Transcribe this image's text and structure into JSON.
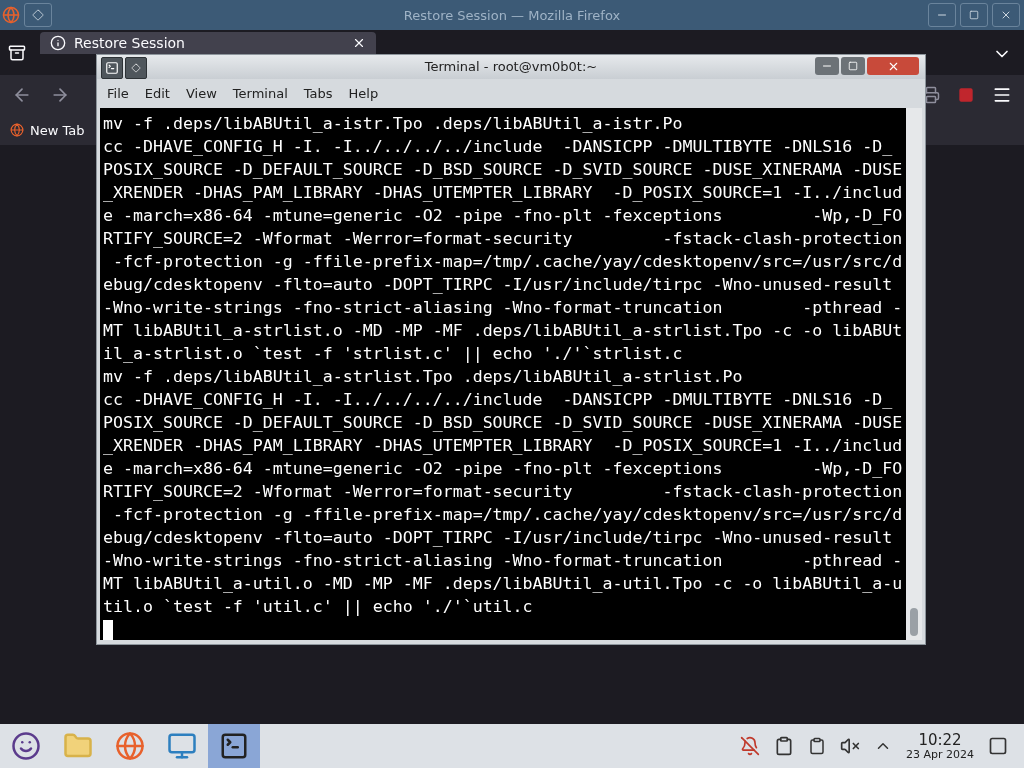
{
  "firefox": {
    "title": "Restore Session — Mozilla Firefox",
    "tab": {
      "label": "Restore Session",
      "selected": true
    },
    "bookmarks": [
      {
        "label": "New Tab"
      }
    ]
  },
  "terminal": {
    "title": "Terminal - root@vm0b0t:~",
    "menu": [
      "File",
      "Edit",
      "View",
      "Terminal",
      "Tabs",
      "Help"
    ],
    "lines": [
      "mv -f .deps/libABUtil_a-istr.Tpo .deps/libABUtil_a-istr.Po",
      "cc -DHAVE_CONFIG_H -I. -I../../../../include  -DANSICPP -DMULTIBYTE -DNLS16 -D_",
      "POSIX_SOURCE -D_DEFAULT_SOURCE -D_BSD_SOURCE -D_SVID_SOURCE -DUSE_XINERAMA -DUSE",
      "_XRENDER -DHAS_PAM_LIBRARY -DHAS_UTEMPTER_LIBRARY  -D_POSIX_SOURCE=1 -I../includ",
      "e -march=x86-64 -mtune=generic -O2 -pipe -fno-plt -fexceptions         -Wp,-D_FO",
      "RTIFY_SOURCE=2 -Wformat -Werror=format-security         -fstack-clash-protection",
      " -fcf-protection -g -ffile-prefix-map=/tmp/.cache/yay/cdesktopenv/src=/usr/src/d",
      "ebug/cdesktopenv -flto=auto -DOPT_TIRPC -I/usr/include/tirpc -Wno-unused-result",
      "-Wno-write-strings -fno-strict-aliasing -Wno-format-truncation        -pthread -",
      "MT libABUtil_a-strlist.o -MD -MP -MF .deps/libABUtil_a-strlist.Tpo -c -o libABUt",
      "il_a-strlist.o `test -f 'strlist.c' || echo './'`strlist.c",
      "mv -f .deps/libABUtil_a-strlist.Tpo .deps/libABUtil_a-strlist.Po",
      "cc -DHAVE_CONFIG_H -I. -I../../../../include  -DANSICPP -DMULTIBYTE -DNLS16 -D_",
      "POSIX_SOURCE -D_DEFAULT_SOURCE -D_BSD_SOURCE -D_SVID_SOURCE -DUSE_XINERAMA -DUSE",
      "_XRENDER -DHAS_PAM_LIBRARY -DHAS_UTEMPTER_LIBRARY  -D_POSIX_SOURCE=1 -I../includ",
      "e -march=x86-64 -mtune=generic -O2 -pipe -fno-plt -fexceptions         -Wp,-D_FO",
      "RTIFY_SOURCE=2 -Wformat -Werror=format-security         -fstack-clash-protection",
      " -fcf-protection -g -ffile-prefix-map=/tmp/.cache/yay/cdesktopenv/src=/usr/src/d",
      "ebug/cdesktopenv -flto=auto -DOPT_TIRPC -I/usr/include/tirpc -Wno-unused-result",
      "-Wno-write-strings -fno-strict-aliasing -Wno-format-truncation        -pthread -",
      "MT libABUtil_a-util.o -MD -MP -MF .deps/libABUtil_a-util.Tpo -c -o libABUtil_a-u",
      "til.o `test -f 'util.c' || echo './'`util.c"
    ]
  },
  "taskbar": {
    "tasks": [
      {
        "selected": false
      },
      {
        "selected": false
      },
      {
        "selected": false
      },
      {
        "selected": true
      }
    ],
    "time": "10:22",
    "date": "23 Apr 2024"
  }
}
